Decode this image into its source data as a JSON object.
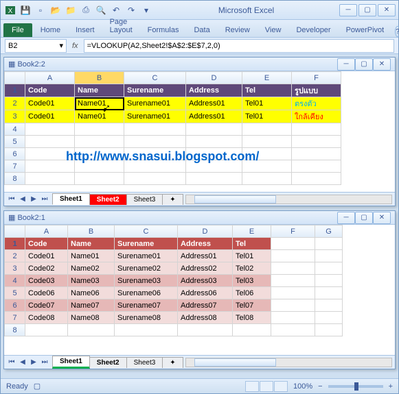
{
  "app": {
    "title": "Microsoft Excel"
  },
  "ribbon": {
    "file": "File",
    "tabs": [
      "Home",
      "Insert",
      "Page Layout",
      "Formulas",
      "Data",
      "Review",
      "View",
      "Developer",
      "PowerPivot"
    ]
  },
  "namebox": "B2",
  "formula": "=VLOOKUP(A2,Sheet2!$A$2:$E$7,2,0)",
  "watermark": "http://www.snasui.blogspot.com/",
  "book_top": {
    "title": "Book2:2",
    "cols": [
      "A",
      "B",
      "C",
      "D",
      "E",
      "F"
    ],
    "header": [
      "Code",
      "Name",
      "Surename",
      "Address",
      "Tel",
      "รูปแบบ"
    ],
    "rows": [
      [
        "Code01",
        "Name01",
        "Surename01",
        "Address01",
        "Tel01",
        "ตรงตัว"
      ],
      [
        "Code01",
        "Name01",
        "Surename01",
        "Address01",
        "Tel01",
        "ใกล้เคียง"
      ]
    ],
    "sheet_tabs": [
      "Sheet1",
      "Sheet2",
      "Sheet3"
    ]
  },
  "book_bottom": {
    "title": "Book2:1",
    "cols": [
      "A",
      "B",
      "C",
      "D",
      "E",
      "F",
      "G"
    ],
    "header": [
      "Code",
      "Name",
      "Surename",
      "Address",
      "Tel"
    ],
    "rows": [
      [
        "Code01",
        "Name01",
        "Surename01",
        "Address01",
        "Tel01"
      ],
      [
        "Code02",
        "Name02",
        "Surename02",
        "Address02",
        "Tel02"
      ],
      [
        "Code03",
        "Name03",
        "Surename03",
        "Address03",
        "Tel03"
      ],
      [
        "Code06",
        "Name06",
        "Surename06",
        "Address06",
        "Tel06"
      ],
      [
        "Code07",
        "Name07",
        "Surename07",
        "Address07",
        "Tel07"
      ],
      [
        "Code08",
        "Name08",
        "Surename08",
        "Address08",
        "Tel08"
      ]
    ],
    "sheet_tabs": [
      "Sheet1",
      "Sheet2",
      "Sheet3"
    ]
  },
  "status": {
    "ready": "Ready",
    "zoom": "100%"
  }
}
